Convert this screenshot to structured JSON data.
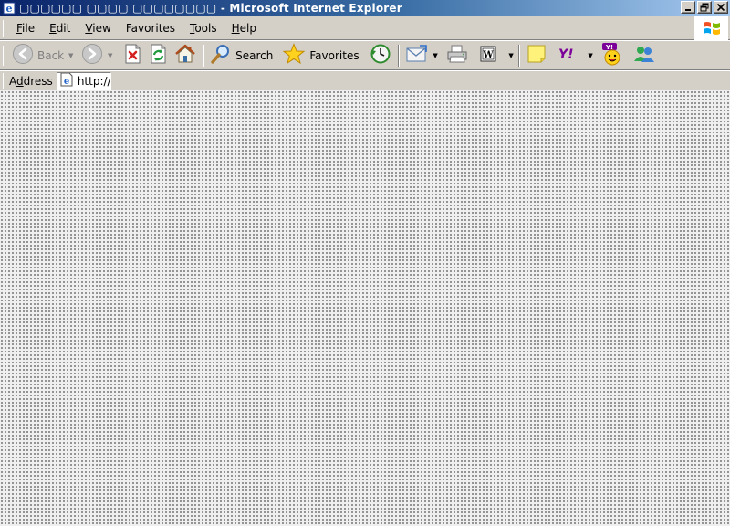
{
  "window": {
    "title": "▢▢▢▢▢▢ ▢▢▢▢ ▢▢▢▢▢▢▢▢ - Microsoft Internet Explorer",
    "controls": [
      "minimize",
      "restore",
      "close"
    ]
  },
  "menu": {
    "items": [
      {
        "key": "F",
        "rest": "ile"
      },
      {
        "key": "E",
        "rest": "dit"
      },
      {
        "key": "V",
        "rest": "iew"
      },
      {
        "key": "F",
        "rest": "avorites",
        "pre": ""
      },
      {
        "key": "T",
        "rest": "ools"
      },
      {
        "key": "H",
        "rest": "elp"
      }
    ]
  },
  "toolbar": {
    "back_label": "Back",
    "search_label": "Search",
    "favorites_label": "Favorites",
    "yahoo_label": "Y!"
  },
  "address": {
    "label_key": "d",
    "label_pre": "A",
    "label_rest": "dress",
    "value": "http://"
  },
  "icons": {
    "app": "ie-icon",
    "back": "back-arrow-icon",
    "forward": "forward-arrow-icon",
    "stop": "stop-icon",
    "refresh": "refresh-icon",
    "home": "home-icon",
    "search": "magnifier-icon",
    "favorites": "star-icon",
    "history": "history-icon",
    "mail": "mail-icon",
    "print": "printer-icon",
    "edit": "word-edit-icon",
    "note": "sticky-note-icon",
    "yahoo": "yahoo-icon",
    "messenger": "yahoo-messenger-icon",
    "msn": "msn-messenger-icon",
    "windows_logo": "windows-logo-icon"
  },
  "colors": {
    "titlebar_start": "#0a246a",
    "titlebar_end": "#a6caf0",
    "chrome": "#d4d0c8",
    "yahoo_purple": "#7b0099"
  }
}
